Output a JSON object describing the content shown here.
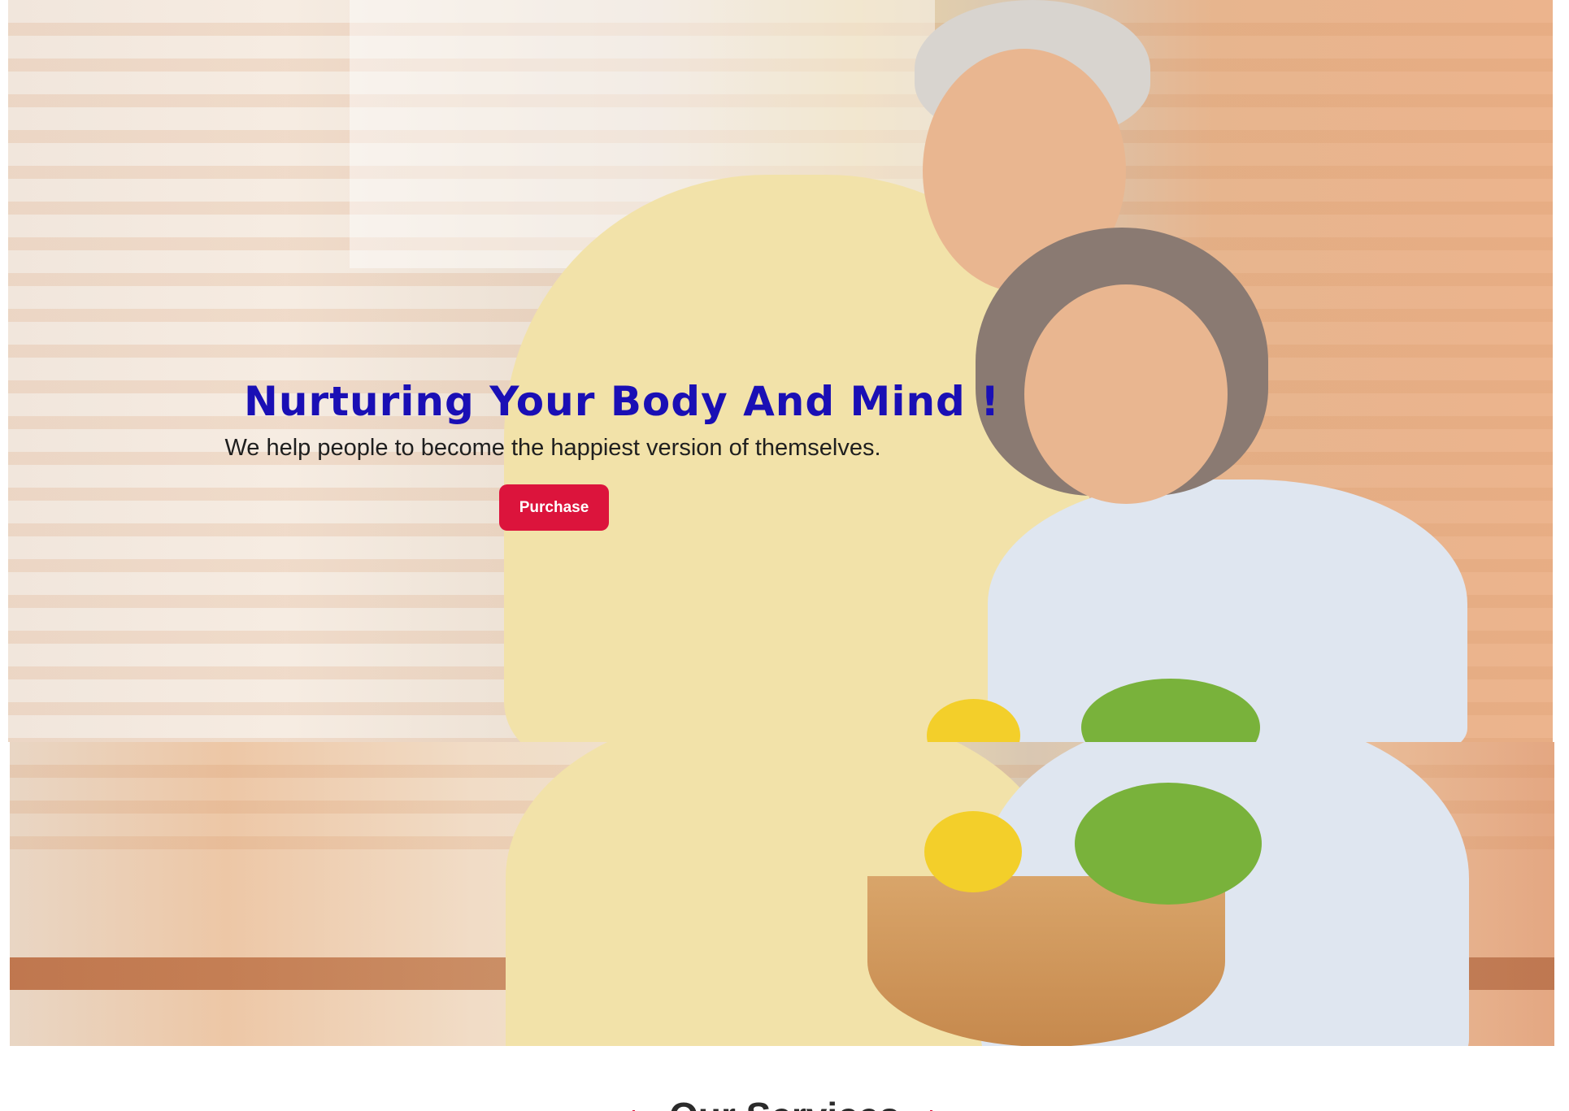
{
  "hero": {
    "title": "Nurturing Your Body And Mind !",
    "subtitle": "We help people to become the happiest version of themselves.",
    "cta_label": "Purchase"
  },
  "services": {
    "title": "Our Services"
  },
  "colors": {
    "title": "#1a0fb5",
    "accent": "#dc143c",
    "text": "#1f1f1f"
  }
}
